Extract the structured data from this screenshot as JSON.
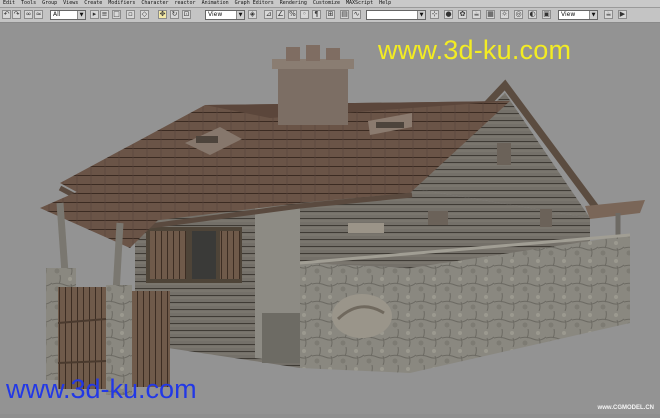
{
  "menu": [
    "Edit",
    "Tools",
    "Group",
    "Views",
    "Create",
    "Modifiers",
    "Character",
    "reactor",
    "Animation",
    "Graph Editors",
    "Rendering",
    "Customize",
    "MAXScript",
    "Help"
  ],
  "toolbar": {
    "selection_filter": "All",
    "ref_coord_left": "View",
    "ref_coord_right": "View"
  },
  "watermarks": {
    "top": "www.3d-ku.com",
    "bottom": "www.3d-ku.com",
    "corner": "www.CGMODEL.CN"
  },
  "colors": {
    "watermark_top": "#f3ec23",
    "watermark_bottom": "#2238e6",
    "viewport_bg": "#939393",
    "roof": "#6d574a",
    "wood_wall": "#75736d",
    "stone": "#8b8a83"
  },
  "icons": [
    "undo-icon",
    "redo-icon",
    "link-icon",
    "unlink-icon",
    "bind-space-warp-icon",
    "select-object-icon",
    "select-by-name-icon",
    "select-region-icon",
    "select-and-move-icon",
    "select-and-rotate-icon",
    "select-and-scale-icon",
    "use-pivot-center-icon",
    "mirror-icon",
    "align-icon",
    "layer-manager-icon",
    "curve-editor-icon",
    "schematic-view-icon",
    "material-editor-icon",
    "render-setup-icon",
    "quick-render-icon"
  ]
}
